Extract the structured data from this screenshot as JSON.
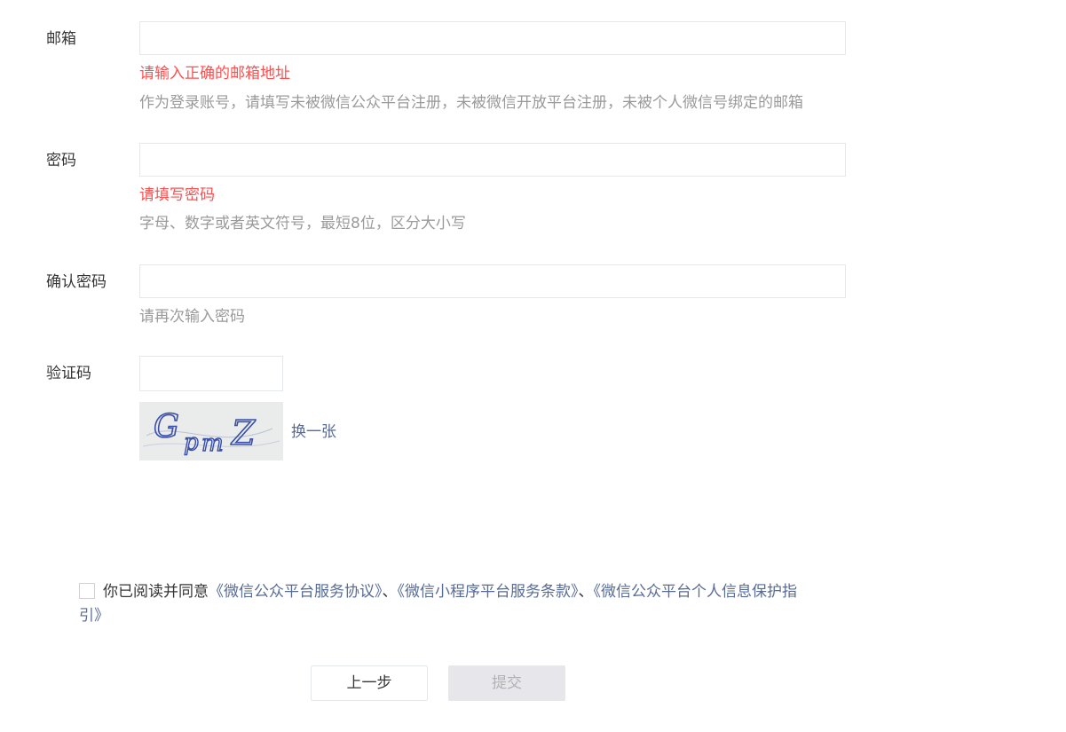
{
  "email": {
    "label": "邮箱",
    "value": "",
    "error": "请输入正确的邮箱地址",
    "tip": "作为登录账号，请填写未被微信公众平台注册，未被微信开放平台注册，未被个人微信号绑定的邮箱"
  },
  "password": {
    "label": "密码",
    "value": "",
    "error": "请填写密码",
    "tip": "字母、数字或者英文符号，最短8位，区分大小写"
  },
  "confirm": {
    "label": "确认密码",
    "value": "",
    "tip": "请再次输入密码"
  },
  "captcha": {
    "label": "验证码",
    "value": "",
    "image_text": "GpmZ",
    "refresh_label": "换一张"
  },
  "agreement": {
    "checked": false,
    "prefix": "你已阅读并同意",
    "link1": "《微信公众平台服务协议》",
    "sep1": "、",
    "link2": "《微信小程序平台服务条款》",
    "sep2": "、",
    "link3": "《微信公众平台个人信息保护指引》"
  },
  "buttons": {
    "prev_label": "上一步",
    "submit_label": "提交"
  },
  "colors": {
    "error": "#fa5151",
    "link": "#576b95",
    "tip": "#9a9a9a",
    "disabled_bg": "#e7e7eb"
  }
}
